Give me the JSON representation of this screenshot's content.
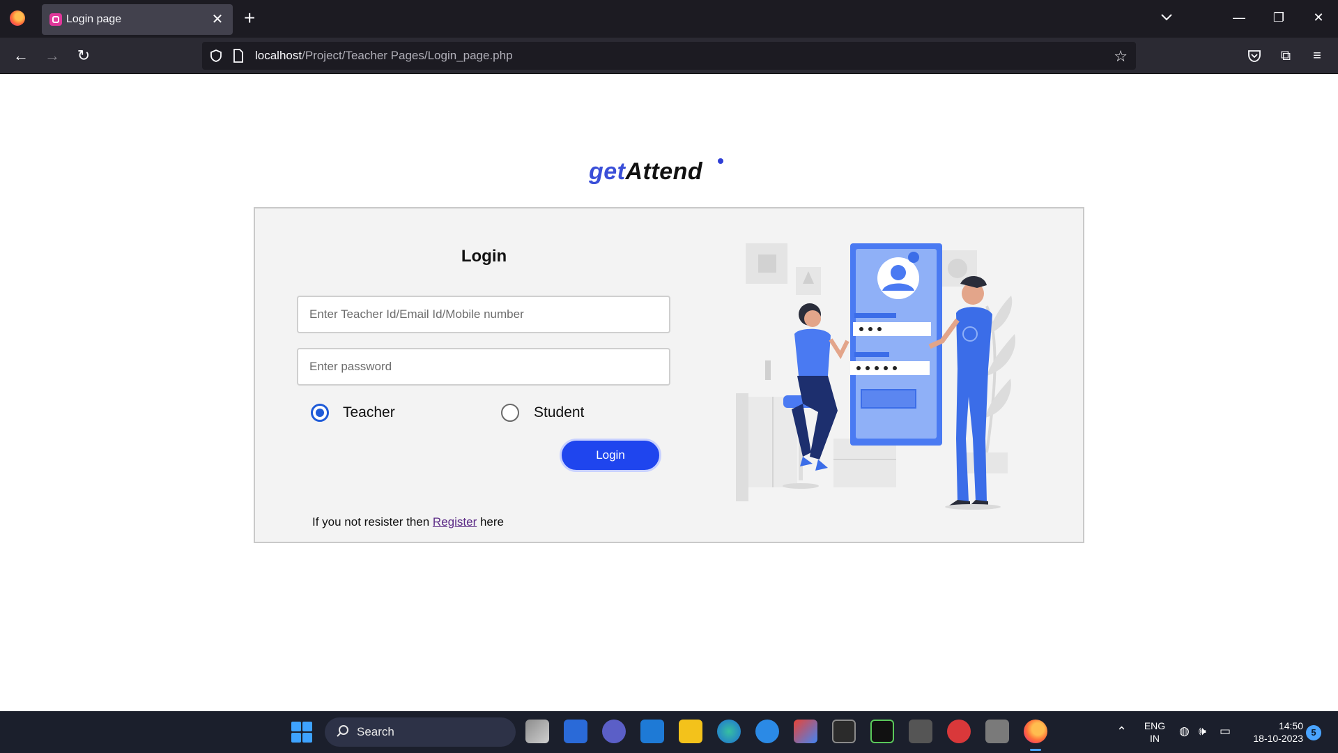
{
  "browser": {
    "tab_title": "Login page",
    "url_host": "localhost",
    "url_path": "/Project/Teacher Pages/Login_page.php"
  },
  "page": {
    "brand_get": "get",
    "brand_attend": "Attend",
    "login_title": "Login",
    "id_placeholder": "Enter Teacher Id/Email Id/Mobile number",
    "password_placeholder": "Enter password",
    "role_teacher": "Teacher",
    "role_student": "Student",
    "selected_role": "Teacher",
    "login_button": "Login",
    "register_prefix": "If you not resister then ",
    "register_link": "Register",
    "register_suffix": " here",
    "accent_color": "#1f45ee"
  },
  "taskbar": {
    "search_label": "Search",
    "lang_top": "ENG",
    "lang_bottom": "IN",
    "time": "14:50",
    "date": "18-10-2023",
    "notification_count": "5"
  }
}
